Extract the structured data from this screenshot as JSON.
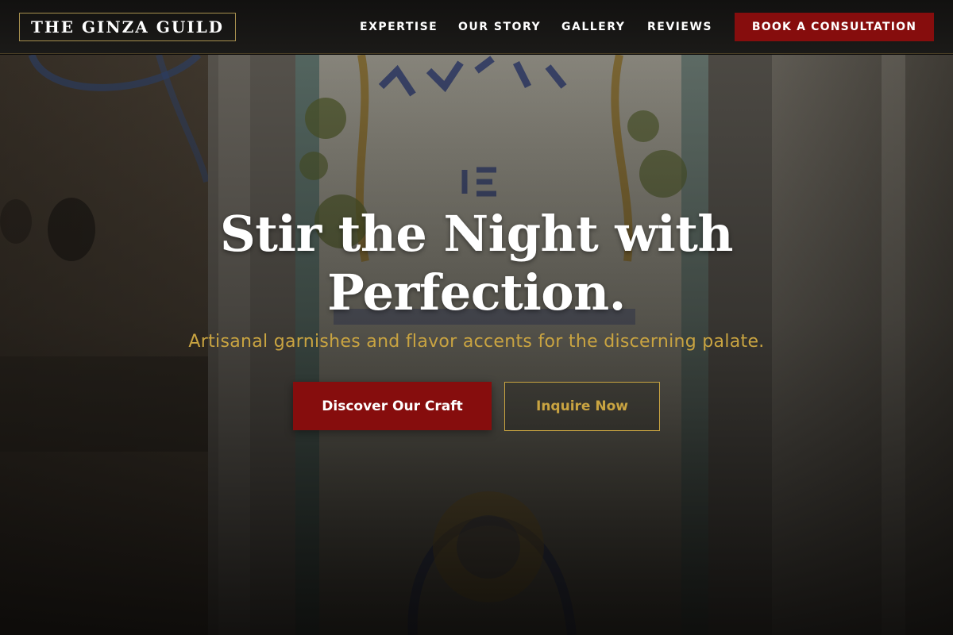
{
  "header": {
    "logo": "THE GINZA GUILD",
    "nav": [
      {
        "label": "EXPERTISE"
      },
      {
        "label": "OUR STORY"
      },
      {
        "label": "GALLERY"
      },
      {
        "label": "REVIEWS"
      }
    ],
    "book_label": "BOOK A CONSULTATION"
  },
  "hero": {
    "title_line1": "Stir the Night with",
    "title_line2": "Perfection.",
    "subtitle": "Artisanal garnishes and flavor accents for the discerning palate.",
    "primary_cta": "Discover Our Craft",
    "secondary_cta": "Inquire Now"
  },
  "colors": {
    "accent_red": "#860d0d",
    "accent_gold": "#c9a441",
    "header_bg": "#151412",
    "text_light": "#ffffff"
  }
}
